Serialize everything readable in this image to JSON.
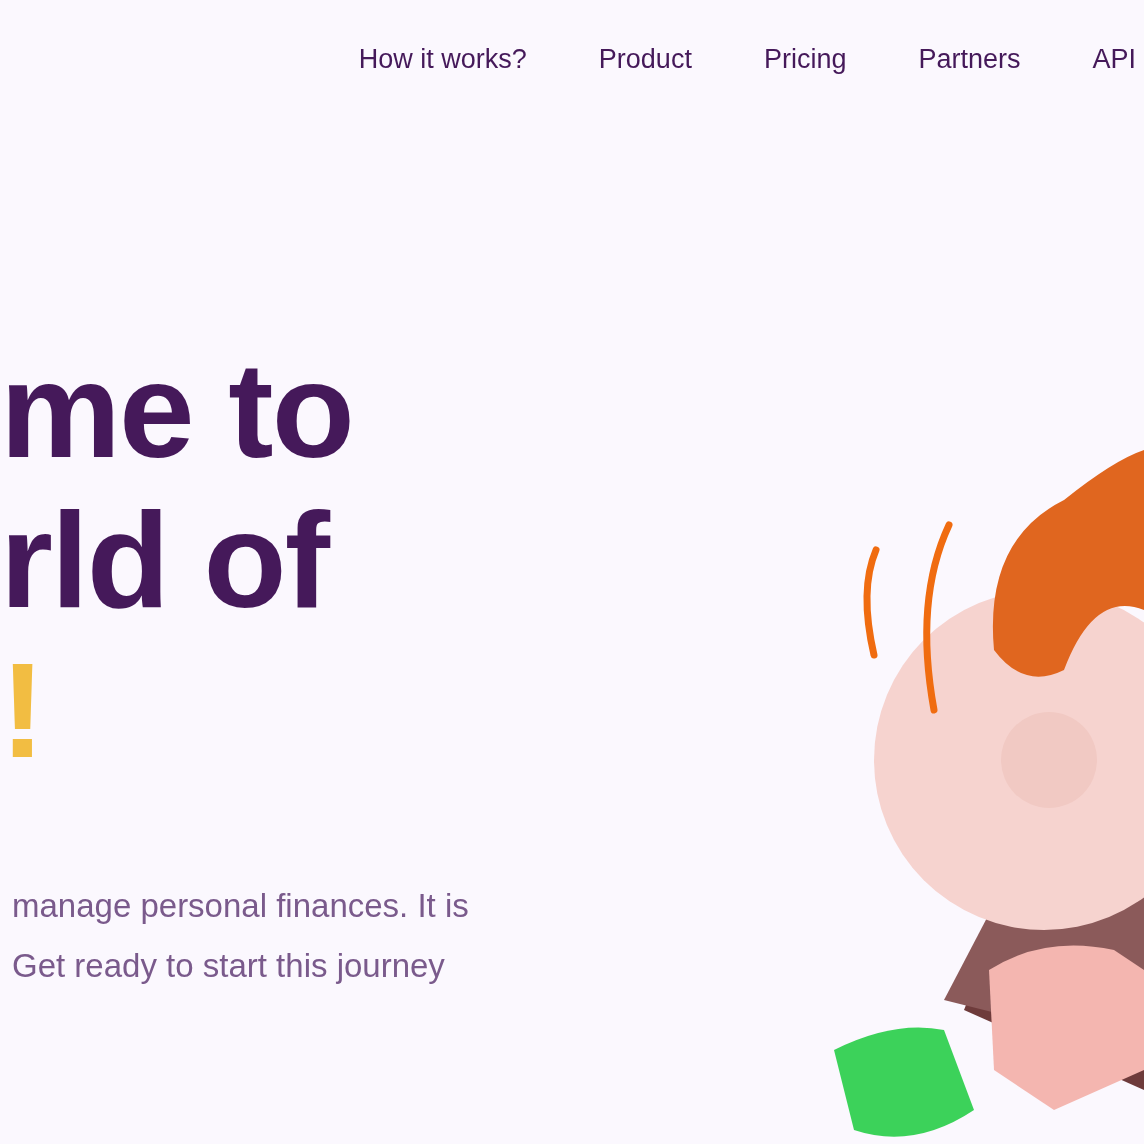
{
  "nav": {
    "links": [
      {
        "label": "How it works?"
      },
      {
        "label": "Product"
      },
      {
        "label": "Pricing"
      },
      {
        "label": "Partners"
      },
      {
        "label": "API"
      }
    ]
  },
  "hero": {
    "headline_lines": [
      "me to",
      "rld of"
    ],
    "accent": "!",
    "description_lines": [
      "manage personal finances. It is",
      "Get ready to start this journey"
    ]
  }
}
